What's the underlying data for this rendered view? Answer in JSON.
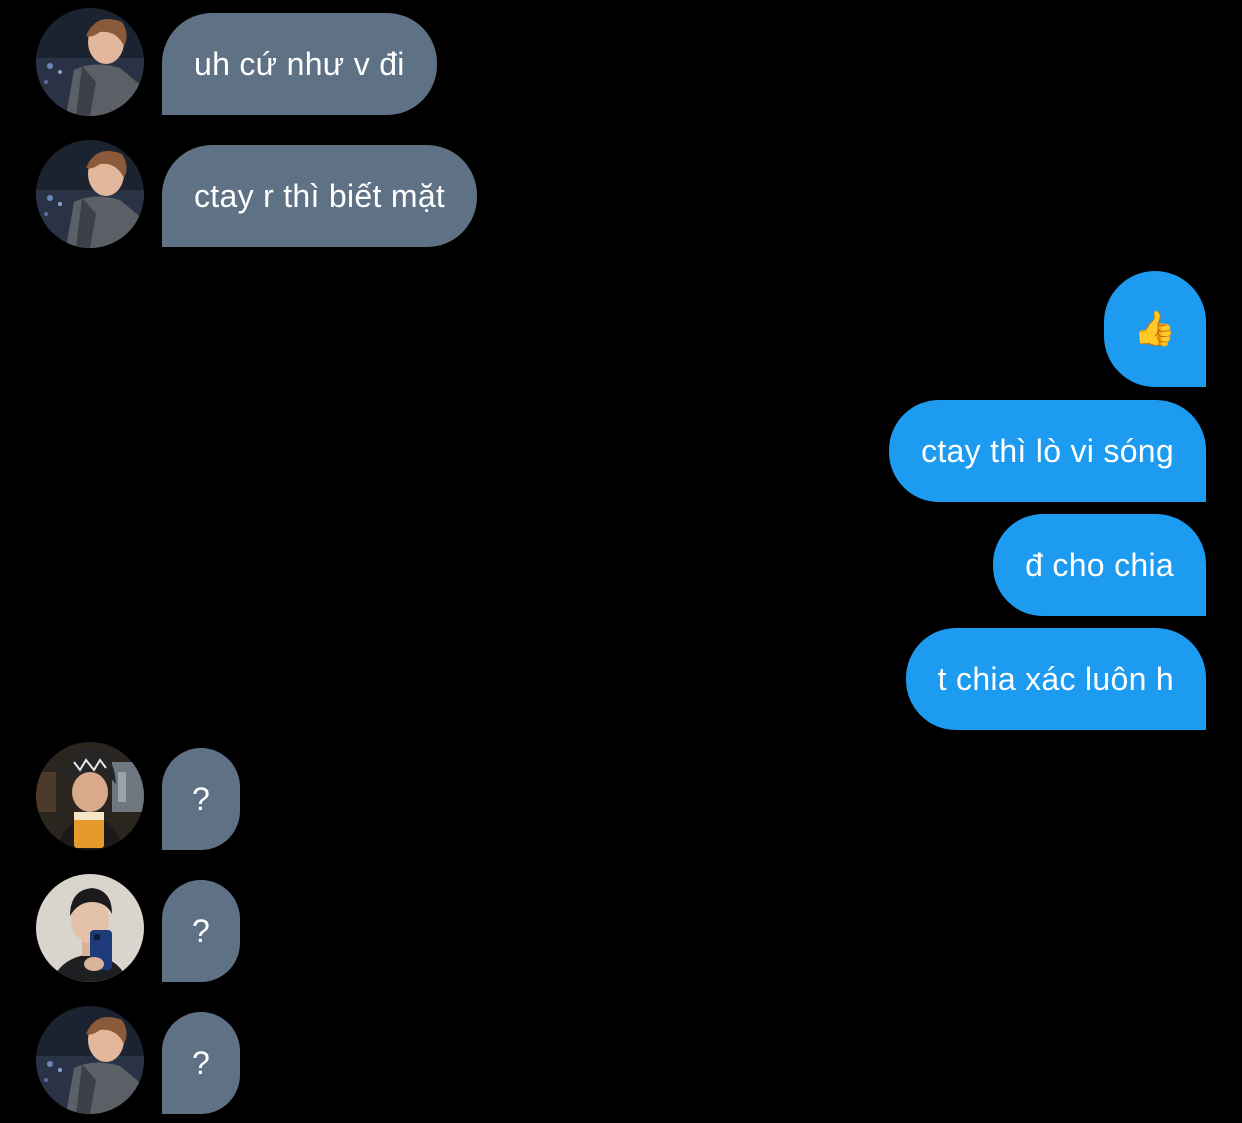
{
  "conversation": {
    "messages": [
      {
        "direction": "incoming",
        "sender": "user-a",
        "text": "uh cứ như v đi"
      },
      {
        "direction": "incoming",
        "sender": "user-a",
        "text": "ctay r thì biết mặt"
      },
      {
        "direction": "outgoing",
        "sender": "self",
        "text": "👍"
      },
      {
        "direction": "outgoing",
        "sender": "self",
        "text": "ctay thì lò vi sóng"
      },
      {
        "direction": "outgoing",
        "sender": "self",
        "text": "đ cho chia"
      },
      {
        "direction": "outgoing",
        "sender": "self",
        "text": "t chia xác luôn h"
      },
      {
        "direction": "incoming",
        "sender": "user-b",
        "text": "?"
      },
      {
        "direction": "incoming",
        "sender": "user-c",
        "text": "?"
      },
      {
        "direction": "incoming",
        "sender": "user-a",
        "text": "?"
      }
    ]
  },
  "colors": {
    "background": "#000000",
    "incoming_bubble": "#5f7184",
    "outgoing_bubble": "#1d9bf0",
    "text": "#ffffff"
  }
}
